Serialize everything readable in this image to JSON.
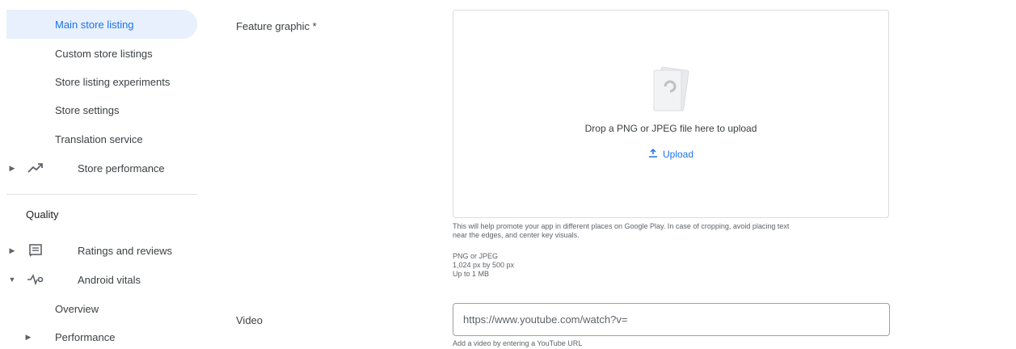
{
  "sidebar": {
    "items": [
      {
        "label": "Main store listing"
      },
      {
        "label": "Custom store listings"
      },
      {
        "label": "Store listing experiments"
      },
      {
        "label": "Store settings"
      },
      {
        "label": "Translation service"
      },
      {
        "label": "Store performance",
        "icon": "trending-up-icon"
      }
    ],
    "quality_heading": "Quality",
    "quality_items": [
      {
        "label": "Ratings and reviews",
        "icon": "reviews-icon"
      },
      {
        "label": "Android vitals",
        "icon": "vitals-icon"
      },
      {
        "label": "Overview"
      },
      {
        "label": "Performance"
      }
    ]
  },
  "feature_graphic": {
    "label": "Feature graphic *",
    "drop_text": "Drop a PNG or JPEG file here to upload",
    "upload_label": "Upload",
    "help_line1": "This will help promote your app in different places on Google Play. In case of cropping, avoid placing text",
    "help_line2": "near the edges, and center key visuals.",
    "format": "PNG or JPEG",
    "dimensions": "1,024 px by 500 px",
    "max_size": "Up to 1 MB"
  },
  "video": {
    "label": "Video",
    "placeholder": "https://www.youtube.com/watch?v=",
    "help": "Add a video by entering a YouTube URL"
  },
  "colors": {
    "accent": "#1a73e8",
    "active_bg": "#e8f0fe"
  }
}
